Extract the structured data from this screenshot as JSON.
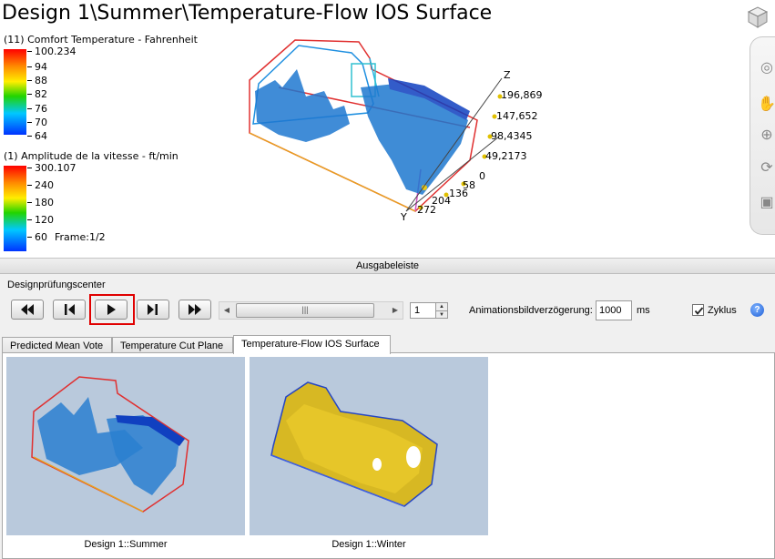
{
  "viewport": {
    "title": "Design 1\\Summer\\Temperature-Flow IOS Surface",
    "legend1": {
      "title": "(11) Comfort Temperature - Fahrenheit",
      "ticks": [
        "100.234",
        "94",
        "88",
        "82",
        "76",
        "70",
        "64"
      ]
    },
    "legend2": {
      "title": "(1) Amplitude de la vitesse - ft/min",
      "ticks": [
        "300.107",
        "240",
        "180",
        "120",
        "60"
      ]
    },
    "frame": "Frame:1/2",
    "axis": {
      "z": "Z",
      "labels": [
        "196,869",
        "147,652",
        "98,4345",
        "49,2173",
        "0",
        "58",
        "136",
        "204",
        "272"
      ],
      "y": "Y"
    },
    "icons": [
      "viewcube-icon",
      "full-navigation-wheel-icon",
      "pan-icon",
      "zoom-icon",
      "orbit-icon",
      "look-at-icon"
    ]
  },
  "output_bar": {
    "title": "Ausgabeleiste",
    "section": "Designprüfungscenter",
    "controls": {
      "frame_value": "1",
      "delay_label": "Animationsbildverzögerung:",
      "delay_value": "1000",
      "delay_unit": "ms",
      "loop_label": "Zyklus",
      "loop_checked": true,
      "help": "?"
    },
    "tabs": [
      {
        "label": "Predicted Mean Vote",
        "active": false
      },
      {
        "label": "Temperature Cut Plane",
        "active": false
      },
      {
        "label": "Temperature-Flow IOS Surface",
        "active": true
      }
    ],
    "thumbnails": [
      {
        "caption": "Design 1::Summer",
        "color": "#2a7fd0"
      },
      {
        "caption": "Design 1::Winter",
        "color": "#d9b81a"
      }
    ]
  },
  "colors": {
    "highlight": "#e00000",
    "panel_bg": "#f0f0f0",
    "thumb_bg": "#b9c9dc"
  }
}
